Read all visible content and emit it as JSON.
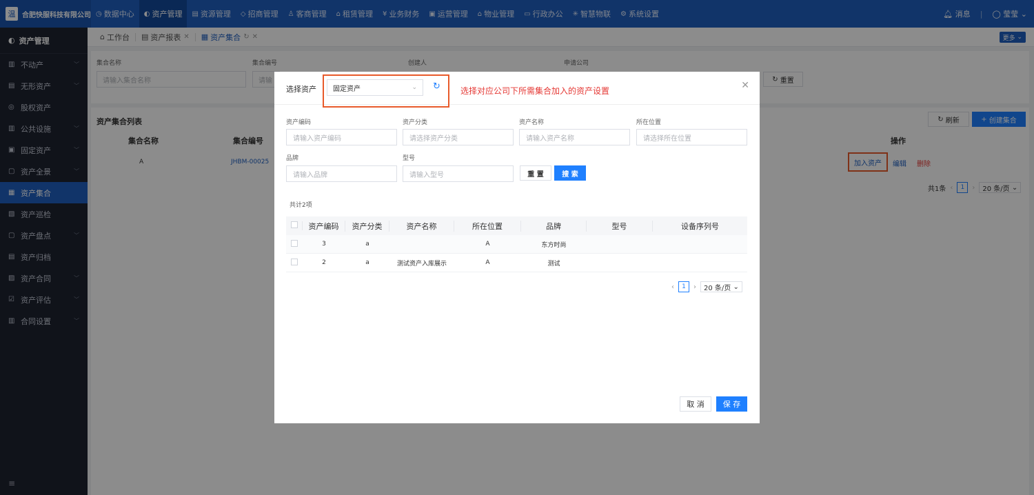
{
  "company": {
    "logo": "温",
    "name": "合肥快服科技有限公司"
  },
  "topnav": [
    {
      "icon": "◷",
      "label": "数据中心",
      "active": false
    },
    {
      "icon": "◐",
      "label": "资产管理",
      "active": true
    },
    {
      "icon": "▤",
      "label": "资源管理",
      "active": false
    },
    {
      "icon": "◇",
      "label": "招商管理",
      "active": false
    },
    {
      "icon": "♙",
      "label": "客商管理",
      "active": false
    },
    {
      "icon": "⌂",
      "label": "租赁管理",
      "active": false
    },
    {
      "icon": "¥",
      "label": "业务财务",
      "active": false
    },
    {
      "icon": "▣",
      "label": "运营管理",
      "active": false
    },
    {
      "icon": "⌂",
      "label": "物业管理",
      "active": false
    },
    {
      "icon": "▭",
      "label": "行政办公",
      "active": false
    },
    {
      "icon": "✳",
      "label": "智慧物联",
      "active": false
    },
    {
      "icon": "⚙",
      "label": "系统设置",
      "active": false
    }
  ],
  "topright": {
    "message": "消息",
    "user": "莹莹"
  },
  "sidebar": {
    "title": "资产管理",
    "items": [
      {
        "label": "不动产",
        "icon": "▥",
        "chev": true
      },
      {
        "label": "无形资产",
        "icon": "▤",
        "chev": true
      },
      {
        "label": "股权资产",
        "icon": "◎",
        "chev": false
      },
      {
        "label": "公共设施",
        "icon": "▥",
        "chev": true
      },
      {
        "label": "固定资产",
        "icon": "▣",
        "chev": true
      },
      {
        "label": "资产全景",
        "icon": "▢",
        "chev": true
      },
      {
        "label": "资产集合",
        "icon": "▦",
        "chev": false
      },
      {
        "label": "资产巡检",
        "icon": "▧",
        "chev": false
      },
      {
        "label": "资产盘点",
        "icon": "▢",
        "chev": true
      },
      {
        "label": "资产归档",
        "icon": "▤",
        "chev": false
      },
      {
        "label": "资产合同",
        "icon": "▨",
        "chev": true
      },
      {
        "label": "资产评估",
        "icon": "☑",
        "chev": true
      },
      {
        "label": "合同设置",
        "icon": "▥",
        "chev": true
      }
    ],
    "footer_icon": "≡"
  },
  "tabs": [
    {
      "label": "工作台",
      "icon": "⌂",
      "closable": false,
      "active": false
    },
    {
      "label": "资产报表",
      "icon": "▤",
      "closable": true,
      "active": false
    },
    {
      "label": "资产集合",
      "icon": "▦",
      "closable": true,
      "active": true
    }
  ],
  "more_label": "更多",
  "filter": {
    "f1_label": "集合名称",
    "f1_placeholder": "请输入集合名称",
    "f2_label": "集合编号",
    "f2_placeholder": "请输",
    "f3_label": "创建人",
    "f4_label": "申请公司",
    "reset": "重置"
  },
  "list": {
    "title": "资产集合列表",
    "refresh": "刷新",
    "create": "创建集合",
    "col_name": "集合名称",
    "col_code": "集合编号",
    "col_op": "操作",
    "row_name": "A",
    "row_code": "JHBM-00025",
    "op_add": "加入资产",
    "op_edit": "编辑",
    "op_del": "删除",
    "total": "共1条",
    "page": "1",
    "pagesize": "20 条/页"
  },
  "modal": {
    "select_label": "选择资产",
    "select_value": "固定资产",
    "note": "选择对应公司下所需集合加入的资产设置",
    "fields": {
      "code_label": "资产编码",
      "code_ph": "请输入资产编码",
      "cat_label": "资产分类",
      "cat_ph": "请选择资产分类",
      "name_label": "资产名称",
      "name_ph": "请输入资产名称",
      "loc_label": "所在位置",
      "loc_ph": "请选择所在位置",
      "brand_label": "品牌",
      "brand_ph": "请输入品牌",
      "model_label": "型号",
      "model_ph": "请输入型号"
    },
    "reset": "重 置",
    "search": "搜 索",
    "total": "共计2项",
    "columns": [
      "资产编码",
      "资产分类",
      "资产名称",
      "所在位置",
      "品牌",
      "型号",
      "设备序列号"
    ],
    "rows": [
      [
        "3",
        "a",
        "",
        "A",
        "东方时尚",
        "",
        ""
      ],
      [
        "2",
        "a",
        "测试资产入库展示",
        "A",
        "测试",
        "",
        ""
      ]
    ],
    "page": "1",
    "pagesize": "20 条/页",
    "cancel": "取 消",
    "save": "保 存"
  }
}
